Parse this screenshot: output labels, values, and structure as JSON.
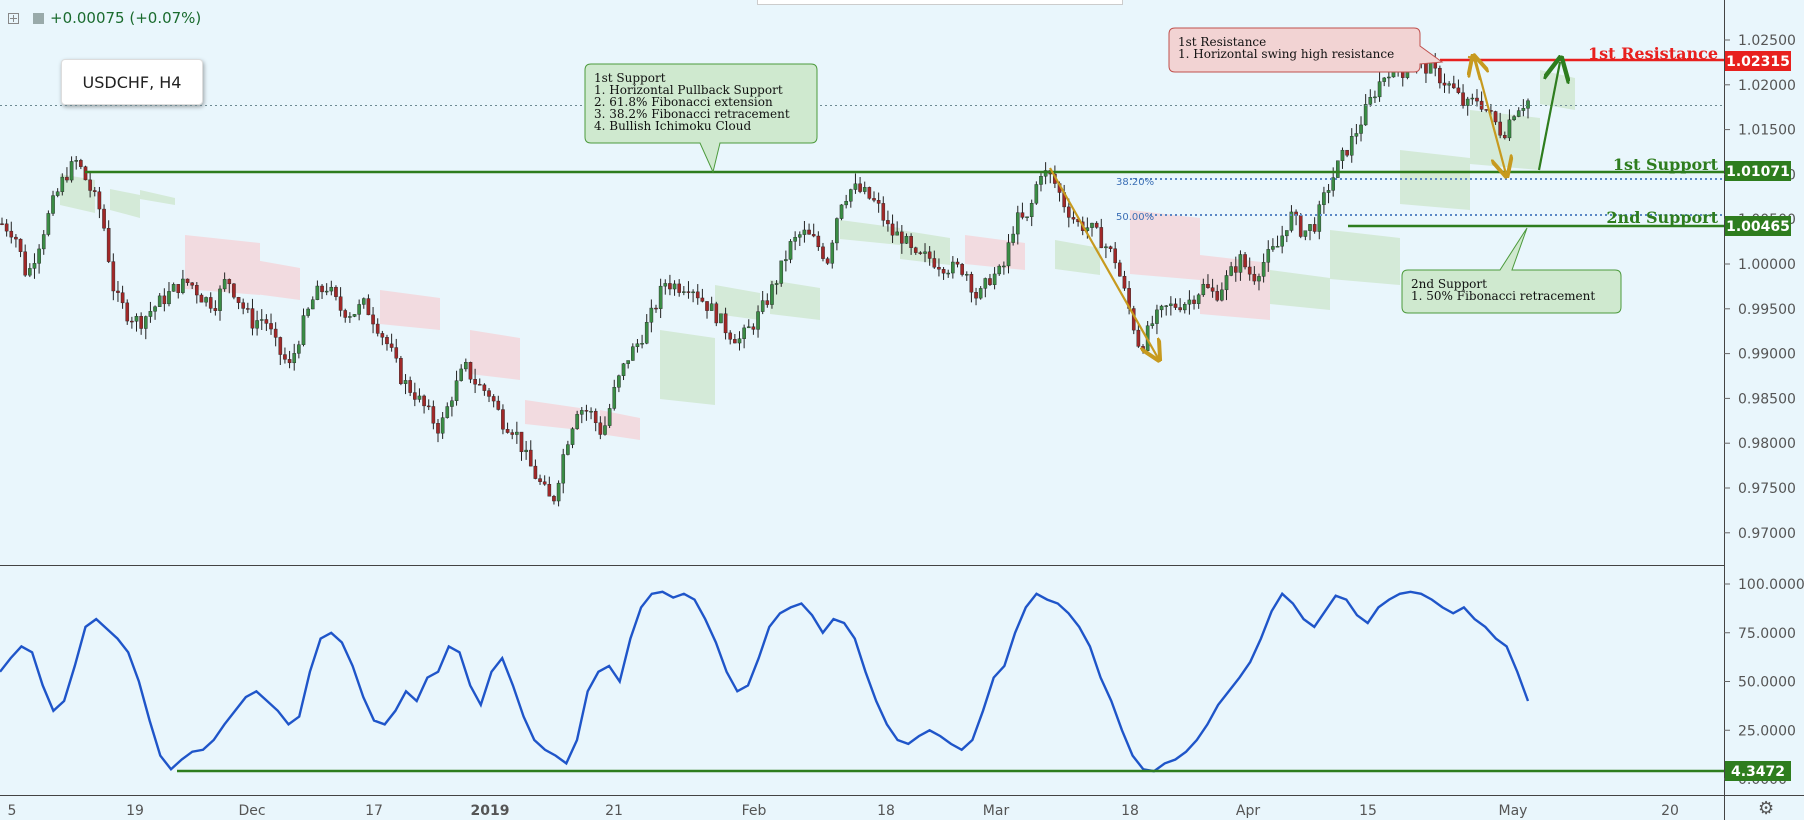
{
  "header": {
    "change_text": "+0.00075 (+0.07%)",
    "symbol_label": "USDCHF, H4",
    "settings_icon": "gear-icon",
    "add_icon": "plus-box-icon"
  },
  "price_axis": {
    "ticks": [
      "1.02500",
      "1.02000",
      "1.01500",
      "1.01000",
      "1.00500",
      "1.00000",
      "0.99500",
      "0.99000",
      "0.98500",
      "0.98000",
      "0.97500",
      "0.97000"
    ]
  },
  "osc_axis": {
    "ticks": [
      "100.0000",
      "75.0000",
      "50.0000",
      "25.0000",
      "0.0000"
    ]
  },
  "time_axis": {
    "labels": [
      "5",
      "19",
      "Dec",
      "17",
      "2019",
      "21",
      "Feb",
      "18",
      "Mar",
      "18",
      "Apr",
      "15",
      "May",
      "20"
    ]
  },
  "levels": {
    "resistance1": {
      "label": "1st Resistance",
      "price_tag": "1.02315",
      "color": "#e8201e",
      "value": 1.02315
    },
    "support1": {
      "label": "1st Support",
      "price_tag": "1.01071",
      "color": "#2e7d1e",
      "value": 1.01071
    },
    "support2": {
      "label": "2nd Support",
      "price_tag": "1.00465",
      "color": "#2e7d1e",
      "value": 1.00465
    },
    "osc_support": {
      "price_tag": "4.3472",
      "color": "#2e7d1e",
      "value": 4.3472
    }
  },
  "fib": {
    "f382": {
      "label": "38.20%",
      "value": 1.0098
    },
    "f50": {
      "label": "50.00%",
      "value": 1.0053
    }
  },
  "annotations": {
    "support1_box": [
      "1st Support",
      "1. Horizontal Pullback Support",
      "2. 61.8% Fibonacci extension",
      "3. 38.2% Fibonacci retracement",
      "4. Bullish Ichimoku Cloud"
    ],
    "resistance1_box": [
      "1st Resistance",
      "1. Horizontal swing high resistance"
    ],
    "support2_box": [
      "2nd Support",
      "1. 50% Fibonacci retracement"
    ]
  },
  "colors": {
    "background": "#e9f6fc",
    "candle_up": "#3a8c45",
    "candle_down": "#a02828",
    "oscillator": "#1f55c9",
    "arrow_gold": "#c79a1f",
    "arrow_green": "#2e7d1e"
  },
  "chart_data": [
    {
      "type": "candlestick",
      "title": "USDCHF, H4",
      "ylim": [
        0.9685,
        1.0265
      ],
      "x_labels": [
        "5",
        "19",
        "Dec",
        "17",
        "2019",
        "21",
        "Feb",
        "18",
        "Mar",
        "18",
        "Apr",
        "15",
        "May",
        "20"
      ],
      "series": [
        {
          "name": "USDCHF",
          "close_path": [
            1.0045,
            1.0035,
            0.9985,
            1.0025,
            1.0065,
            1.0098,
            1.0115,
            1.0085,
            1.0055,
            0.9965,
            0.9945,
            0.9935,
            0.995,
            0.9962,
            0.9975,
            0.998,
            0.9963,
            0.9955,
            0.9985,
            0.9958,
            0.9935,
            0.994,
            0.9905,
            0.9885,
            0.993,
            0.9965,
            0.9975,
            0.995,
            0.9945,
            0.9955,
            0.9932,
            0.9905,
            0.987,
            0.9855,
            0.9835,
            0.9815,
            0.9855,
            0.9885,
            0.9865,
            0.9855,
            0.9825,
            0.9815,
            0.978,
            0.9755,
            0.9732,
            0.9795,
            0.984,
            0.9835,
            0.981,
            0.986,
            0.9895,
            0.9915,
            0.9945,
            0.998,
            0.9975,
            0.9978,
            0.996,
            0.9945,
            0.9925,
            0.9915,
            0.9932,
            0.9955,
            0.9985,
            1.002,
            1.0035,
            1.0025,
            1.0005,
            1.007,
            1.0085,
            1.0078,
            1.0065,
            1.0035,
            1.003,
            1.0005,
            1.0008,
            1.0,
            0.9995,
            0.9995,
            0.996,
            0.9985,
            0.9992,
            1.005,
            1.0048,
            1.0105,
            1.0095,
            1.0065,
            1.0045,
            1.004,
            1.0025,
            1.0005,
            0.9955,
            0.9905,
            0.9935,
            0.995,
            0.9955,
            0.996,
            0.9975,
            0.9965,
            0.9985,
            1.0005,
            0.9985,
            1.0005,
            1.002,
            1.0055,
            1.0035,
            1.0045,
            1.0085,
            1.0115,
            1.014,
            1.017,
            1.02,
            1.022,
            1.0215,
            1.023,
            1.0218,
            1.0208,
            1.0195,
            1.0175,
            1.0185,
            1.0165,
            1.0145,
            1.0175,
            1.0182
          ]
        }
      ],
      "ichimoku_cloud": "bullish below price at the end"
    },
    {
      "type": "line",
      "name": "oscillator",
      "ylim": [
        0,
        105
      ],
      "series": [
        {
          "name": "oscillator",
          "values": [
            55,
            62,
            68,
            65,
            48,
            35,
            40,
            58,
            78,
            82,
            77,
            72,
            65,
            50,
            30,
            12,
            5,
            10,
            14,
            15,
            20,
            28,
            35,
            42,
            45,
            40,
            35,
            28,
            32,
            55,
            72,
            75,
            70,
            58,
            42,
            30,
            28,
            35,
            45,
            40,
            52,
            55,
            68,
            65,
            48,
            38,
            55,
            62,
            48,
            32,
            20,
            15,
            12,
            8,
            20,
            45,
            55,
            58,
            50,
            72,
            88,
            95,
            96,
            93,
            95,
            92,
            82,
            70,
            55,
            45,
            48,
            62,
            78,
            85,
            88,
            90,
            84,
            75,
            82,
            80,
            72,
            55,
            40,
            28,
            20,
            18,
            22,
            25,
            22,
            18,
            15,
            20,
            35,
            52,
            58,
            75,
            88,
            95,
            92,
            90,
            85,
            78,
            68,
            52,
            40,
            25,
            12,
            5,
            4,
            8,
            10,
            14,
            20,
            28,
            38,
            45,
            52,
            60,
            72,
            86,
            95,
            90,
            82,
            78,
            86,
            94,
            92,
            84,
            80,
            88,
            92,
            95,
            96,
            95,
            92,
            88,
            85,
            88,
            82,
            78,
            72,
            68,
            55,
            40
          ]
        }
      ],
      "reference_line": 4.3472
    }
  ]
}
